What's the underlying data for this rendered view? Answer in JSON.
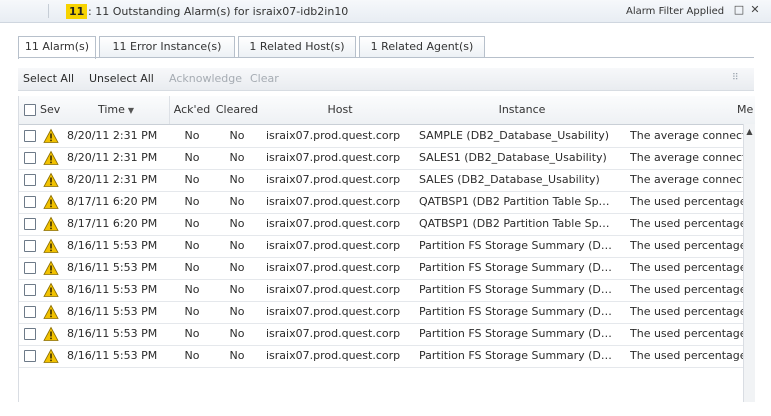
{
  "window": {
    "count_badge": "11",
    "title": ": 11 Outstanding Alarm(s) for israix07-idb2in10",
    "filter_label": "Alarm Filter  Applied",
    "restore_glyph": "□",
    "close_glyph": "✕"
  },
  "tabs": [
    {
      "label": "11 Alarm(s)",
      "active": true
    },
    {
      "label": "11 Error Instance(s)",
      "active": false
    },
    {
      "label": "1 Related Host(s)",
      "active": false
    },
    {
      "label": "1 Related Agent(s)",
      "active": false
    }
  ],
  "toolbar": {
    "select_all": "Select All",
    "unselect_all": "Unselect All",
    "acknowledge": "Acknowledge",
    "clear": "Clear",
    "grip_icon": "⠿"
  },
  "columns": {
    "sev": "Sev",
    "time": "Time",
    "time_sort": "▼",
    "acked": "Ack'ed",
    "cleared": "Cleared",
    "host": "Host",
    "instance": "Instance",
    "message": "Me"
  },
  "rows": [
    {
      "time": "8/20/11 2:31 PM",
      "acked": "No",
      "cleared": "No",
      "host": "israix07.prod.quest.corp",
      "instance": "SAMPLE (DB2_Database_Usability)",
      "message": "The average connecti"
    },
    {
      "time": "8/20/11 2:31 PM",
      "acked": "No",
      "cleared": "No",
      "host": "israix07.prod.quest.corp",
      "instance": "SALES1 (DB2_Database_Usability)",
      "message": "The average connecti"
    },
    {
      "time": "8/20/11 2:31 PM",
      "acked": "No",
      "cleared": "No",
      "host": "israix07.prod.quest.corp",
      "instance": "SALES (DB2_Database_Usability)",
      "message": "The average connecti"
    },
    {
      "time": "8/17/11 6:20 PM",
      "acked": "No",
      "cleared": "No",
      "host": "israix07.prod.quest.corp",
      "instance": "QATBSP1 (DB2 Partition Table Sp…",
      "message": "The used percentage"
    },
    {
      "time": "8/17/11 6:20 PM",
      "acked": "No",
      "cleared": "No",
      "host": "israix07.prod.quest.corp",
      "instance": "QATBSP1 (DB2 Partition Table Sp…",
      "message": "The used percentage"
    },
    {
      "time": "8/16/11 5:53 PM",
      "acked": "No",
      "cleared": "No",
      "host": "israix07.prod.quest.corp",
      "instance": "Partition FS Storage Summary (D…",
      "message": "The used percentage"
    },
    {
      "time": "8/16/11 5:53 PM",
      "acked": "No",
      "cleared": "No",
      "host": "israix07.prod.quest.corp",
      "instance": "Partition FS Storage Summary (D…",
      "message": "The used percentage"
    },
    {
      "time": "8/16/11 5:53 PM",
      "acked": "No",
      "cleared": "No",
      "host": "israix07.prod.quest.corp",
      "instance": "Partition FS Storage Summary (D…",
      "message": "The used percentage"
    },
    {
      "time": "8/16/11 5:53 PM",
      "acked": "No",
      "cleared": "No",
      "host": "israix07.prod.quest.corp",
      "instance": "Partition FS Storage Summary (D…",
      "message": "The used percentage"
    },
    {
      "time": "8/16/11 5:53 PM",
      "acked": "No",
      "cleared": "No",
      "host": "israix07.prod.quest.corp",
      "instance": "Partition FS Storage Summary (D…",
      "message": "The used percentage"
    },
    {
      "time": "8/16/11 5:53 PM",
      "acked": "No",
      "cleared": "No",
      "host": "israix07.prod.quest.corp",
      "instance": "Partition FS Storage Summary (D…",
      "message": "The used percentage"
    }
  ],
  "scrollbar": {
    "up_glyph": "▲"
  },
  "colors": {
    "count_badge": "#f7d300",
    "warning": "#f2c200",
    "disabled_text": "#a6acb3"
  },
  "icons": {
    "severity": "warning-triangle-icon"
  }
}
